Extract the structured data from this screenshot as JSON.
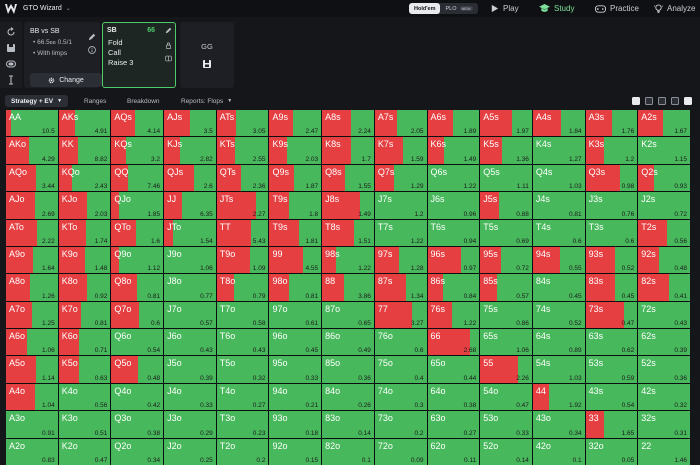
{
  "topbar": {
    "app_title": "GTO Wizard",
    "game_toggle": {
      "holdem": "Hold'em",
      "plo": "PLO",
      "new_badge": "NEW"
    },
    "nav": {
      "play": "Play",
      "study": "Study",
      "practice": "Practice",
      "analyze": "Analyze"
    }
  },
  "spot": {
    "title": "BB vs SB",
    "line1": "66.5",
    "line1_unit": "BB",
    "line1_blinds": "0.5/1",
    "line2": "With limps",
    "change": "Change"
  },
  "action_card": {
    "position": "SB",
    "stack": "66",
    "options": [
      "Fold",
      "Call",
      "Raise 3"
    ]
  },
  "gg_panel": {
    "label": "GG"
  },
  "tabs": {
    "strategy": "Strategy + EV",
    "ranges": "Ranges",
    "breakdown": "Breakdown",
    "reports": "Reports: Flops"
  },
  "colors": {
    "fold": "#e63f42",
    "call": "#48b85c",
    "accent": "#4ecc6b"
  },
  "grid": [
    [
      [
        "AA",
        "10.5",
        0.09
      ],
      [
        "AKs",
        "4.91",
        0.32
      ],
      [
        "AQs",
        "4.14",
        0.46
      ],
      [
        "AJs",
        "3.5",
        0.5
      ],
      [
        "ATs",
        "3.05",
        0.38
      ],
      [
        "A9s",
        "2.47",
        0.46
      ],
      [
        "A8s",
        "2.24",
        0.56
      ],
      [
        "A7s",
        "2.05",
        0.43
      ],
      [
        "A6s",
        "1.89",
        0.49
      ],
      [
        "A5s",
        "1.97",
        0.61
      ],
      [
        "A4s",
        "1.84",
        0.55
      ],
      [
        "A3s",
        "1.76",
        0.51
      ],
      [
        "A2s",
        "1.67",
        0.48
      ]
    ],
    [
      [
        "AKo",
        "4.29",
        0.44
      ],
      [
        "KK",
        "8.82",
        0.37
      ],
      [
        "KQs",
        "3.2",
        0.28
      ],
      [
        "KJs",
        "2.82",
        0.3
      ],
      [
        "KTs",
        "2.55",
        0.36
      ],
      [
        "K9s",
        "2.03",
        0.33
      ],
      [
        "K8s",
        "1.7",
        0.55
      ],
      [
        "K7s",
        "1.59",
        0.54
      ],
      [
        "K6s",
        "1.49",
        0.32
      ],
      [
        "K5s",
        "1.36",
        0.42
      ],
      [
        "K4s",
        "1.27",
        0.0
      ],
      [
        "K3s",
        "1.2",
        0.36
      ],
      [
        "K2s",
        "1.15",
        0.0
      ]
    ],
    [
      [
        "AQo",
        "3.44",
        0.59
      ],
      [
        "KQo",
        "2.43",
        0.26
      ],
      [
        "QQ",
        "7.46",
        0.33
      ],
      [
        "QJs",
        "2.6",
        0.58
      ],
      [
        "QTs",
        "2.36",
        0.47
      ],
      [
        "Q9s",
        "1.87",
        0.47
      ],
      [
        "Q8s",
        "1.55",
        0.45
      ],
      [
        "Q7s",
        "1.29",
        0.37
      ],
      [
        "Q6s",
        "1.22",
        0.0
      ],
      [
        "Q5s",
        "1.11",
        0.0
      ],
      [
        "Q4s",
        "1.03",
        0.0
      ],
      [
        "Q3s",
        "0.98",
        0.66
      ],
      [
        "Q2s",
        "0.93",
        0.3
      ]
    ],
    [
      [
        "AJo",
        "2.69",
        0.57
      ],
      [
        "KJo",
        "2.03",
        0.54
      ],
      [
        "QJo",
        "1.85",
        0.14
      ],
      [
        "JJ",
        "6.35",
        0.34
      ],
      [
        "JTs",
        "2.27",
        0.75
      ],
      [
        "T9s",
        "1.8",
        0.37
      ],
      [
        "J8s",
        "1.49",
        0.74
      ],
      [
        "J7s",
        "1.2",
        0.0
      ],
      [
        "J6s",
        "0.96",
        0.0
      ],
      [
        "J5s",
        "0.88",
        0.37
      ],
      [
        "J4s",
        "0.81",
        0.0
      ],
      [
        "J3s",
        "0.76",
        0.0
      ],
      [
        "J2s",
        "0.72",
        0.0
      ]
    ],
    [
      [
        "ATo",
        "2.22",
        0.6
      ],
      [
        "KTo",
        "1.74",
        0.53
      ],
      [
        "QTo",
        "1.6",
        0.48
      ],
      [
        "JTo",
        "1.54",
        0.18
      ],
      [
        "TT",
        "5.43",
        0.67
      ],
      [
        "T9s",
        "1.81",
        0.57
      ],
      [
        "T8s",
        "1.51",
        0.61
      ],
      [
        "T7s",
        "1.22",
        0.0
      ],
      [
        "T6s",
        "0.94",
        0.0
      ],
      [
        "T5s",
        "0.69",
        0.0
      ],
      [
        "T4s",
        "0.6",
        0.0
      ],
      [
        "T3s",
        "0.6",
        0.0
      ],
      [
        "T2s",
        "0.56",
        0.55
      ]
    ],
    [
      [
        "A9o",
        "1.64",
        0.53
      ],
      [
        "K9o",
        "1.48",
        0.51
      ],
      [
        "Q9o",
        "1.12",
        0.15
      ],
      [
        "J9o",
        "1.06",
        0.0
      ],
      [
        "T9o",
        "1.09",
        0.64
      ],
      [
        "99",
        "4.55",
        0.64
      ],
      [
        "98s",
        "1.22",
        0.27
      ],
      [
        "97s",
        "1.28",
        0.46
      ],
      [
        "96s",
        "0.97",
        0.64
      ],
      [
        "95s",
        "0.72",
        0.41
      ],
      [
        "94s",
        "0.55",
        0.52
      ],
      [
        "93s",
        "0.52",
        0.56
      ],
      [
        "92s",
        "0.48",
        0.4
      ]
    ],
    [
      [
        "A8o",
        "1.26",
        0.46
      ],
      [
        "K8o",
        "0.92",
        0.54
      ],
      [
        "Q8o",
        "0.81",
        0.5
      ],
      [
        "J8o",
        "0.77",
        0.0
      ],
      [
        "T8o",
        "0.79",
        0.34
      ],
      [
        "98o",
        "0.81",
        0.38
      ],
      [
        "88",
        "3.86",
        0.42
      ],
      [
        "87s",
        "1.34",
        0.61
      ],
      [
        "86s",
        "0.84",
        0.3
      ],
      [
        "85s",
        "0.57",
        0.33
      ],
      [
        "84s",
        "0.45",
        0.0
      ],
      [
        "83s",
        "0.45",
        0.56
      ],
      [
        "82s",
        "0.41",
        0.6
      ]
    ],
    [
      [
        "A7o",
        "1.25",
        0.51
      ],
      [
        "K7o",
        "0.81",
        0.44
      ],
      [
        "Q7o",
        "0.6",
        0.54
      ],
      [
        "J7o",
        "0.57",
        0.0
      ],
      [
        "T7o",
        "0.58",
        0.0
      ],
      [
        "97o",
        "0.61",
        0.0
      ],
      [
        "87o",
        "0.65",
        0.0
      ],
      [
        "77",
        "3.27",
        0.71
      ],
      [
        "76s",
        "1.22",
        0.48
      ],
      [
        "75s",
        "0.86",
        0.0
      ],
      [
        "74s",
        "0.52",
        0.0
      ],
      [
        "73s",
        "0.47",
        0.75
      ],
      [
        "72s",
        "0.43",
        0.0
      ]
    ],
    [
      [
        "A6o",
        "1.06",
        0.41
      ],
      [
        "K6o",
        "0.71",
        0.4
      ],
      [
        "Q6o",
        "0.54",
        0.0
      ],
      [
        "J6o",
        "0.43",
        0.0
      ],
      [
        "T6o",
        "0.43",
        0.0
      ],
      [
        "96o",
        "0.45",
        0.0
      ],
      [
        "86o",
        "0.49",
        0.0
      ],
      [
        "76o",
        "0.6",
        0.0
      ],
      [
        "66",
        "2.68",
        0.82
      ],
      [
        "65s",
        "1.06",
        0.0
      ],
      [
        "64s",
        "0.89",
        0.0
      ],
      [
        "63s",
        "0.62",
        0.0
      ],
      [
        "62s",
        "0.39",
        0.0
      ]
    ],
    [
      [
        "A5o",
        "1.14",
        0.59
      ],
      [
        "K5o",
        "0.63",
        0.4
      ],
      [
        "Q5o",
        "0.48",
        0.52
      ],
      [
        "J5o",
        "0.39",
        0.0
      ],
      [
        "T5o",
        "0.32",
        0.0
      ],
      [
        "95o",
        "0.33",
        0.0
      ],
      [
        "85o",
        "0.36",
        0.0
      ],
      [
        "75o",
        "0.4",
        0.0
      ],
      [
        "65o",
        "0.44",
        0.0
      ],
      [
        "55",
        "2.26",
        0.73
      ],
      [
        "54s",
        "1.03",
        0.0
      ],
      [
        "53s",
        "0.59",
        0.0
      ],
      [
        "52s",
        "0.36",
        0.0
      ]
    ],
    [
      [
        "A4o",
        "1.04",
        0.56
      ],
      [
        "K4o",
        "0.56",
        0.0
      ],
      [
        "Q4o",
        "0.42",
        0.0
      ],
      [
        "J4o",
        "0.33",
        0.0
      ],
      [
        "T4o",
        "0.27",
        0.0
      ],
      [
        "94o",
        "0.21",
        0.0
      ],
      [
        "84o",
        "0.26",
        0.0
      ],
      [
        "74o",
        "0.3",
        0.0
      ],
      [
        "64o",
        "0.38",
        0.0
      ],
      [
        "54o",
        "0.47",
        0.0
      ],
      [
        "44",
        "1.92",
        0.32
      ],
      [
        "43s",
        "0.54",
        0.0
      ],
      [
        "42s",
        "0.32",
        0.0
      ]
    ],
    [
      [
        "A3o",
        "0.91",
        0.0
      ],
      [
        "K3o",
        "0.51",
        0.0
      ],
      [
        "Q3o",
        "0.38",
        0.0
      ],
      [
        "J3o",
        "0.29",
        0.0
      ],
      [
        "T3o",
        "0.23",
        0.0
      ],
      [
        "93o",
        "0.18",
        0.0
      ],
      [
        "83o",
        "0.14",
        0.0
      ],
      [
        "73o",
        "0.2",
        0.0
      ],
      [
        "63o",
        "0.27",
        0.0
      ],
      [
        "53o",
        "0.33",
        0.0
      ],
      [
        "43o",
        "0.34",
        0.0
      ],
      [
        "33",
        "1.65",
        0.35
      ],
      [
        "32s",
        "0.31",
        0.0
      ]
    ],
    [
      [
        "A2o",
        "0.83",
        0.0
      ],
      [
        "K2o",
        "0.47",
        0.0
      ],
      [
        "Q2o",
        "0.34",
        0.0
      ],
      [
        "J2o",
        "0.25",
        0.0
      ],
      [
        "T2o",
        "0.2",
        0.0
      ],
      [
        "92o",
        "0.15",
        0.0
      ],
      [
        "82o",
        "0.1",
        0.0
      ],
      [
        "72o",
        "0.09",
        0.0
      ],
      [
        "62o",
        "0.11",
        0.0
      ],
      [
        "52o",
        "0.14",
        0.0
      ],
      [
        "42o",
        "0.1",
        0.0
      ],
      [
        "32o",
        "0.05",
        0.0
      ],
      [
        "22",
        "1.46",
        0.0
      ]
    ]
  ]
}
